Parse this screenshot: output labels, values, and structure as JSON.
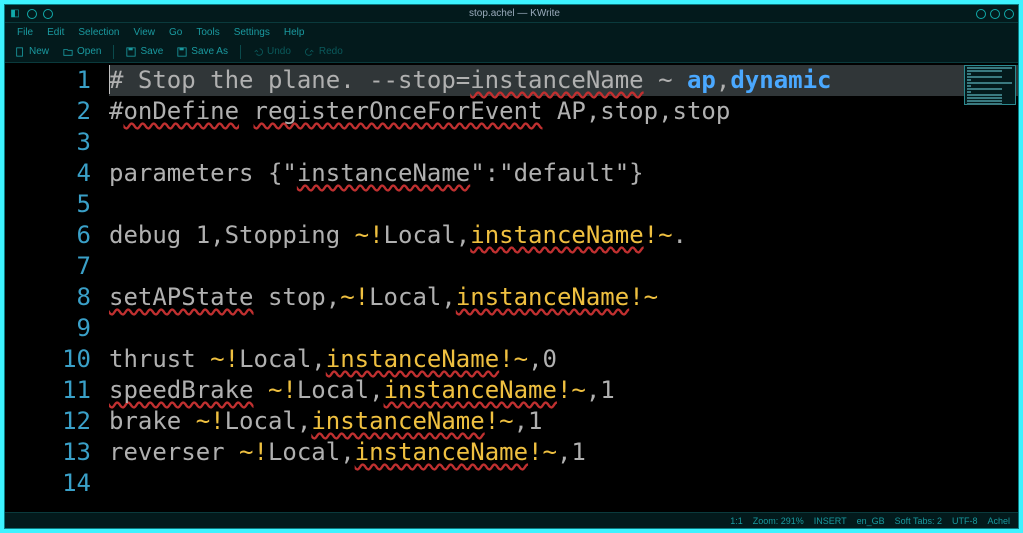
{
  "window": {
    "title": "stop.achel — KWrite"
  },
  "menubar": {
    "items": [
      "File",
      "Edit",
      "Selection",
      "View",
      "Go",
      "Tools",
      "Settings",
      "Help"
    ]
  },
  "toolbar": {
    "new_label": "New",
    "open_label": "Open",
    "save_label": "Save",
    "save_as_label": "Save As",
    "undo_label": "Undo",
    "redo_label": "Redo"
  },
  "editor": {
    "line_count": 14,
    "current_line": 1,
    "lines": [
      [
        {
          "t": "# Stop the plane. --stop=",
          "c": "tok-comment"
        },
        {
          "t": "instanceName",
          "c": "tok-spell"
        },
        {
          "t": " ~ ",
          "c": "tok-comment"
        },
        {
          "t": "ap",
          "c": "tok-kw2"
        },
        {
          "t": ",",
          "c": "tok-comment"
        },
        {
          "t": "dynamic",
          "c": "tok-kw2"
        }
      ],
      [
        {
          "t": "#",
          "c": "tok-comment"
        },
        {
          "t": "onDefine",
          "c": "tok-spell"
        },
        {
          "t": " ",
          "c": "tok-comment"
        },
        {
          "t": "registerOnceForEvent",
          "c": "tok-spell"
        },
        {
          "t": " AP,stop,stop",
          "c": "tok-comment"
        }
      ],
      [],
      [
        {
          "t": "parameters {\"",
          "c": "tok-plain"
        },
        {
          "t": "instanceName",
          "c": "tok-spell"
        },
        {
          "t": "\":\"default\"}",
          "c": "tok-plain"
        }
      ],
      [],
      [
        {
          "t": "debug 1,Stopping ",
          "c": "tok-plain"
        },
        {
          "t": "~!",
          "c": "tok-op"
        },
        {
          "t": "Local,",
          "c": "tok-plain"
        },
        {
          "t": "instanceName",
          "c": "tok-spell-y"
        },
        {
          "t": "!~",
          "c": "tok-op"
        },
        {
          "t": ".",
          "c": "tok-plain"
        }
      ],
      [],
      [
        {
          "t": "setAPState",
          "c": "tok-spell"
        },
        {
          "t": " stop,",
          "c": "tok-plain"
        },
        {
          "t": "~!",
          "c": "tok-op"
        },
        {
          "t": "Local,",
          "c": "tok-plain"
        },
        {
          "t": "instanceName",
          "c": "tok-spell-y"
        },
        {
          "t": "!~",
          "c": "tok-op"
        }
      ],
      [],
      [
        {
          "t": "thrust ",
          "c": "tok-plain"
        },
        {
          "t": "~!",
          "c": "tok-op"
        },
        {
          "t": "Local,",
          "c": "tok-plain"
        },
        {
          "t": "instanceName",
          "c": "tok-spell-y"
        },
        {
          "t": "!~",
          "c": "tok-op"
        },
        {
          "t": ",0",
          "c": "tok-plain"
        }
      ],
      [
        {
          "t": "speedBrake",
          "c": "tok-spell"
        },
        {
          "t": " ",
          "c": "tok-plain"
        },
        {
          "t": "~!",
          "c": "tok-op"
        },
        {
          "t": "Local,",
          "c": "tok-plain"
        },
        {
          "t": "instanceName",
          "c": "tok-spell-y"
        },
        {
          "t": "!~",
          "c": "tok-op"
        },
        {
          "t": ",1",
          "c": "tok-plain"
        }
      ],
      [
        {
          "t": "brake ",
          "c": "tok-plain"
        },
        {
          "t": "~!",
          "c": "tok-op"
        },
        {
          "t": "Local,",
          "c": "tok-plain"
        },
        {
          "t": "instanceName",
          "c": "tok-spell-y"
        },
        {
          "t": "!~",
          "c": "tok-op"
        },
        {
          "t": ",1",
          "c": "tok-plain"
        }
      ],
      [
        {
          "t": "reverser ",
          "c": "tok-plain"
        },
        {
          "t": "~!",
          "c": "tok-op"
        },
        {
          "t": "Local,",
          "c": "tok-plain"
        },
        {
          "t": "instanceName",
          "c": "tok-spell-y"
        },
        {
          "t": "!~",
          "c": "tok-op"
        },
        {
          "t": ",1",
          "c": "tok-plain"
        }
      ],
      []
    ]
  },
  "statusbar": {
    "cursor": "1:1",
    "zoom": "Zoom: 291%",
    "mode": "INSERT",
    "locale": "en_GB",
    "tabs": "Soft Tabs: 2",
    "encoding": "UTF-8",
    "syntax": "Achel"
  }
}
